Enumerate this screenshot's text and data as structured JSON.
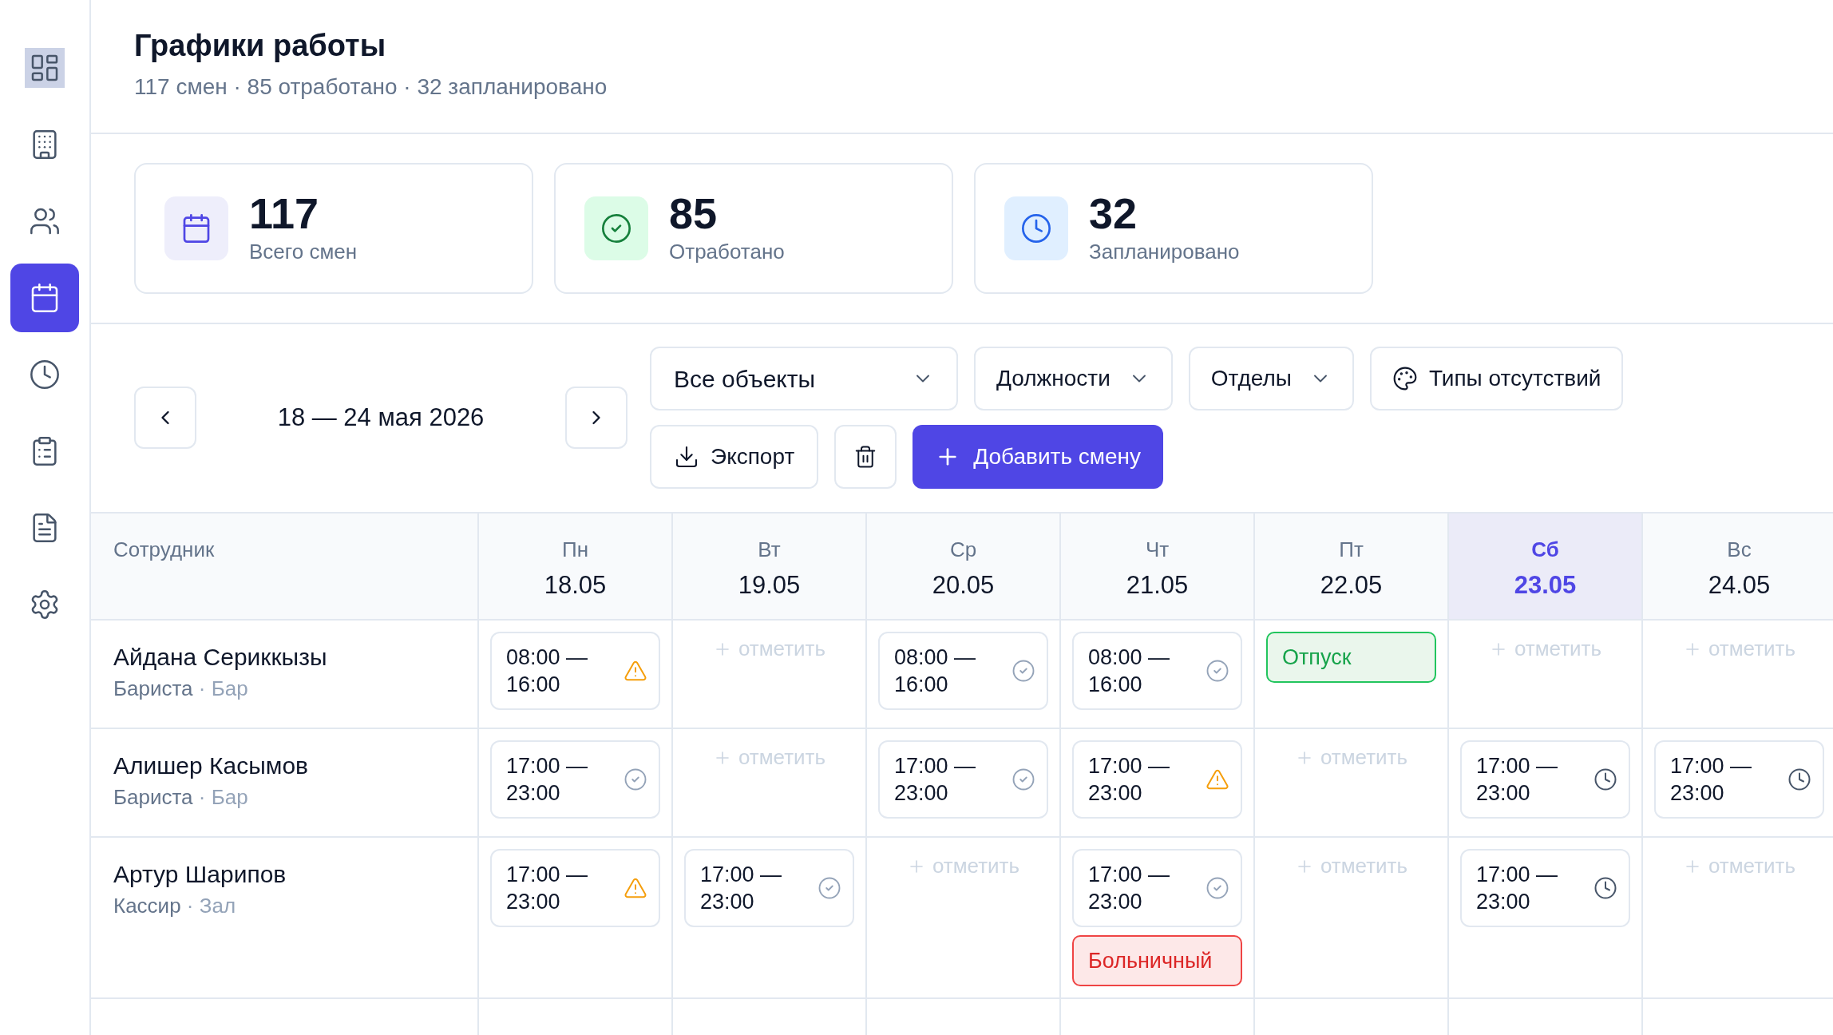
{
  "sidebar": {
    "items": [
      {
        "kind": "dashboard",
        "selected": false,
        "hovered": true
      },
      {
        "kind": "building",
        "selected": false,
        "hovered": false
      },
      {
        "kind": "users",
        "selected": false,
        "hovered": false
      },
      {
        "kind": "calendar",
        "selected": true,
        "hovered": false
      },
      {
        "kind": "clock",
        "selected": false,
        "hovered": false
      },
      {
        "kind": "clipboard",
        "selected": false,
        "hovered": false
      },
      {
        "kind": "document",
        "selected": false,
        "hovered": false
      },
      {
        "kind": "settings",
        "selected": false,
        "hovered": false
      }
    ]
  },
  "header": {
    "title": "Графики работы",
    "subtitle": "117 смен · 85 отработано · 32 запланировано"
  },
  "stats": [
    {
      "kind": "total",
      "value": "117",
      "label": "Всего смен"
    },
    {
      "kind": "done",
      "value": "85",
      "label": "Отработано"
    },
    {
      "kind": "planned",
      "value": "32",
      "label": "Запланировано"
    }
  ],
  "toolbar": {
    "period": "18 — 24 мая 2026",
    "dropdowns": [
      {
        "kind": "wide",
        "label": "Все объекты"
      },
      {
        "kind": "normal",
        "label": "Должности"
      },
      {
        "kind": "normal",
        "label": "Отделы"
      }
    ],
    "absence_types_button": "Типы отсутствий",
    "export_button": "Экспорт",
    "add_button": "Добавить смену"
  },
  "table": {
    "employee_header": "Сотрудник",
    "days": [
      {
        "weekday": "Пн",
        "date": "18.05",
        "selected": false
      },
      {
        "weekday": "Вт",
        "date": "19.05",
        "selected": false
      },
      {
        "weekday": "Ср",
        "date": "20.05",
        "selected": false
      },
      {
        "weekday": "Чт",
        "date": "21.05",
        "selected": false
      },
      {
        "weekday": "Пт",
        "date": "22.05",
        "selected": false
      },
      {
        "weekday": "Сб",
        "date": "23.05",
        "selected": true
      },
      {
        "weekday": "Вс",
        "date": "24.05",
        "selected": false
      }
    ],
    "rows": [
      {
        "name": "Айдана Сериккызы",
        "role": "Бариста",
        "separator": "·",
        "department": "Бар",
        "cells": [
          {
            "shift": {
              "time": "08:00 — 16:00",
              "kind": "warning"
            }
          },
          {
            "add_label": "отметить"
          },
          {
            "shift": {
              "time": "08:00 — 16:00",
              "kind": "done"
            }
          },
          {
            "shift": {
              "time": "08:00 — 16:00",
              "kind": "done"
            }
          },
          {
            "absence": {
              "kind": "vacation",
              "label": "Отпуск"
            }
          },
          {
            "add_label": "отметить"
          },
          {
            "add_label": "отметить"
          }
        ]
      },
      {
        "name": "Алишер Касымов",
        "role": "Бариста",
        "separator": "·",
        "department": "Бар",
        "cells": [
          {
            "shift": {
              "time": "17:00 — 23:00",
              "kind": "done"
            }
          },
          {
            "add_label": "отметить"
          },
          {
            "shift": {
              "time": "17:00 — 23:00",
              "kind": "done"
            }
          },
          {
            "shift": {
              "time": "17:00 — 23:00",
              "kind": "warning"
            }
          },
          {
            "add_label": "отметить"
          },
          {
            "shift": {
              "time": "17:00 — 23:00",
              "kind": "planned"
            }
          },
          {
            "shift": {
              "time": "17:00 — 23:00",
              "kind": "planned"
            }
          }
        ]
      },
      {
        "name": "Артур Шарипов",
        "role": "Кассир",
        "separator": "·",
        "department": "Зал",
        "cells": [
          {
            "shift": {
              "time": "17:00 — 23:00",
              "kind": "warning"
            }
          },
          {
            "shift": {
              "time": "17:00 — 23:00",
              "kind": "done"
            }
          },
          {
            "add_label": "отметить"
          },
          {
            "shift": {
              "time": "17:00 — 23:00",
              "kind": "done"
            },
            "absence": {
              "kind": "sick",
              "label": "Больничный"
            }
          },
          {
            "add_label": "отметить"
          },
          {
            "shift": {
              "time": "17:00 — 23:00",
              "kind": "planned"
            }
          },
          {
            "add_label": "отметить"
          }
        ]
      }
    ]
  }
}
